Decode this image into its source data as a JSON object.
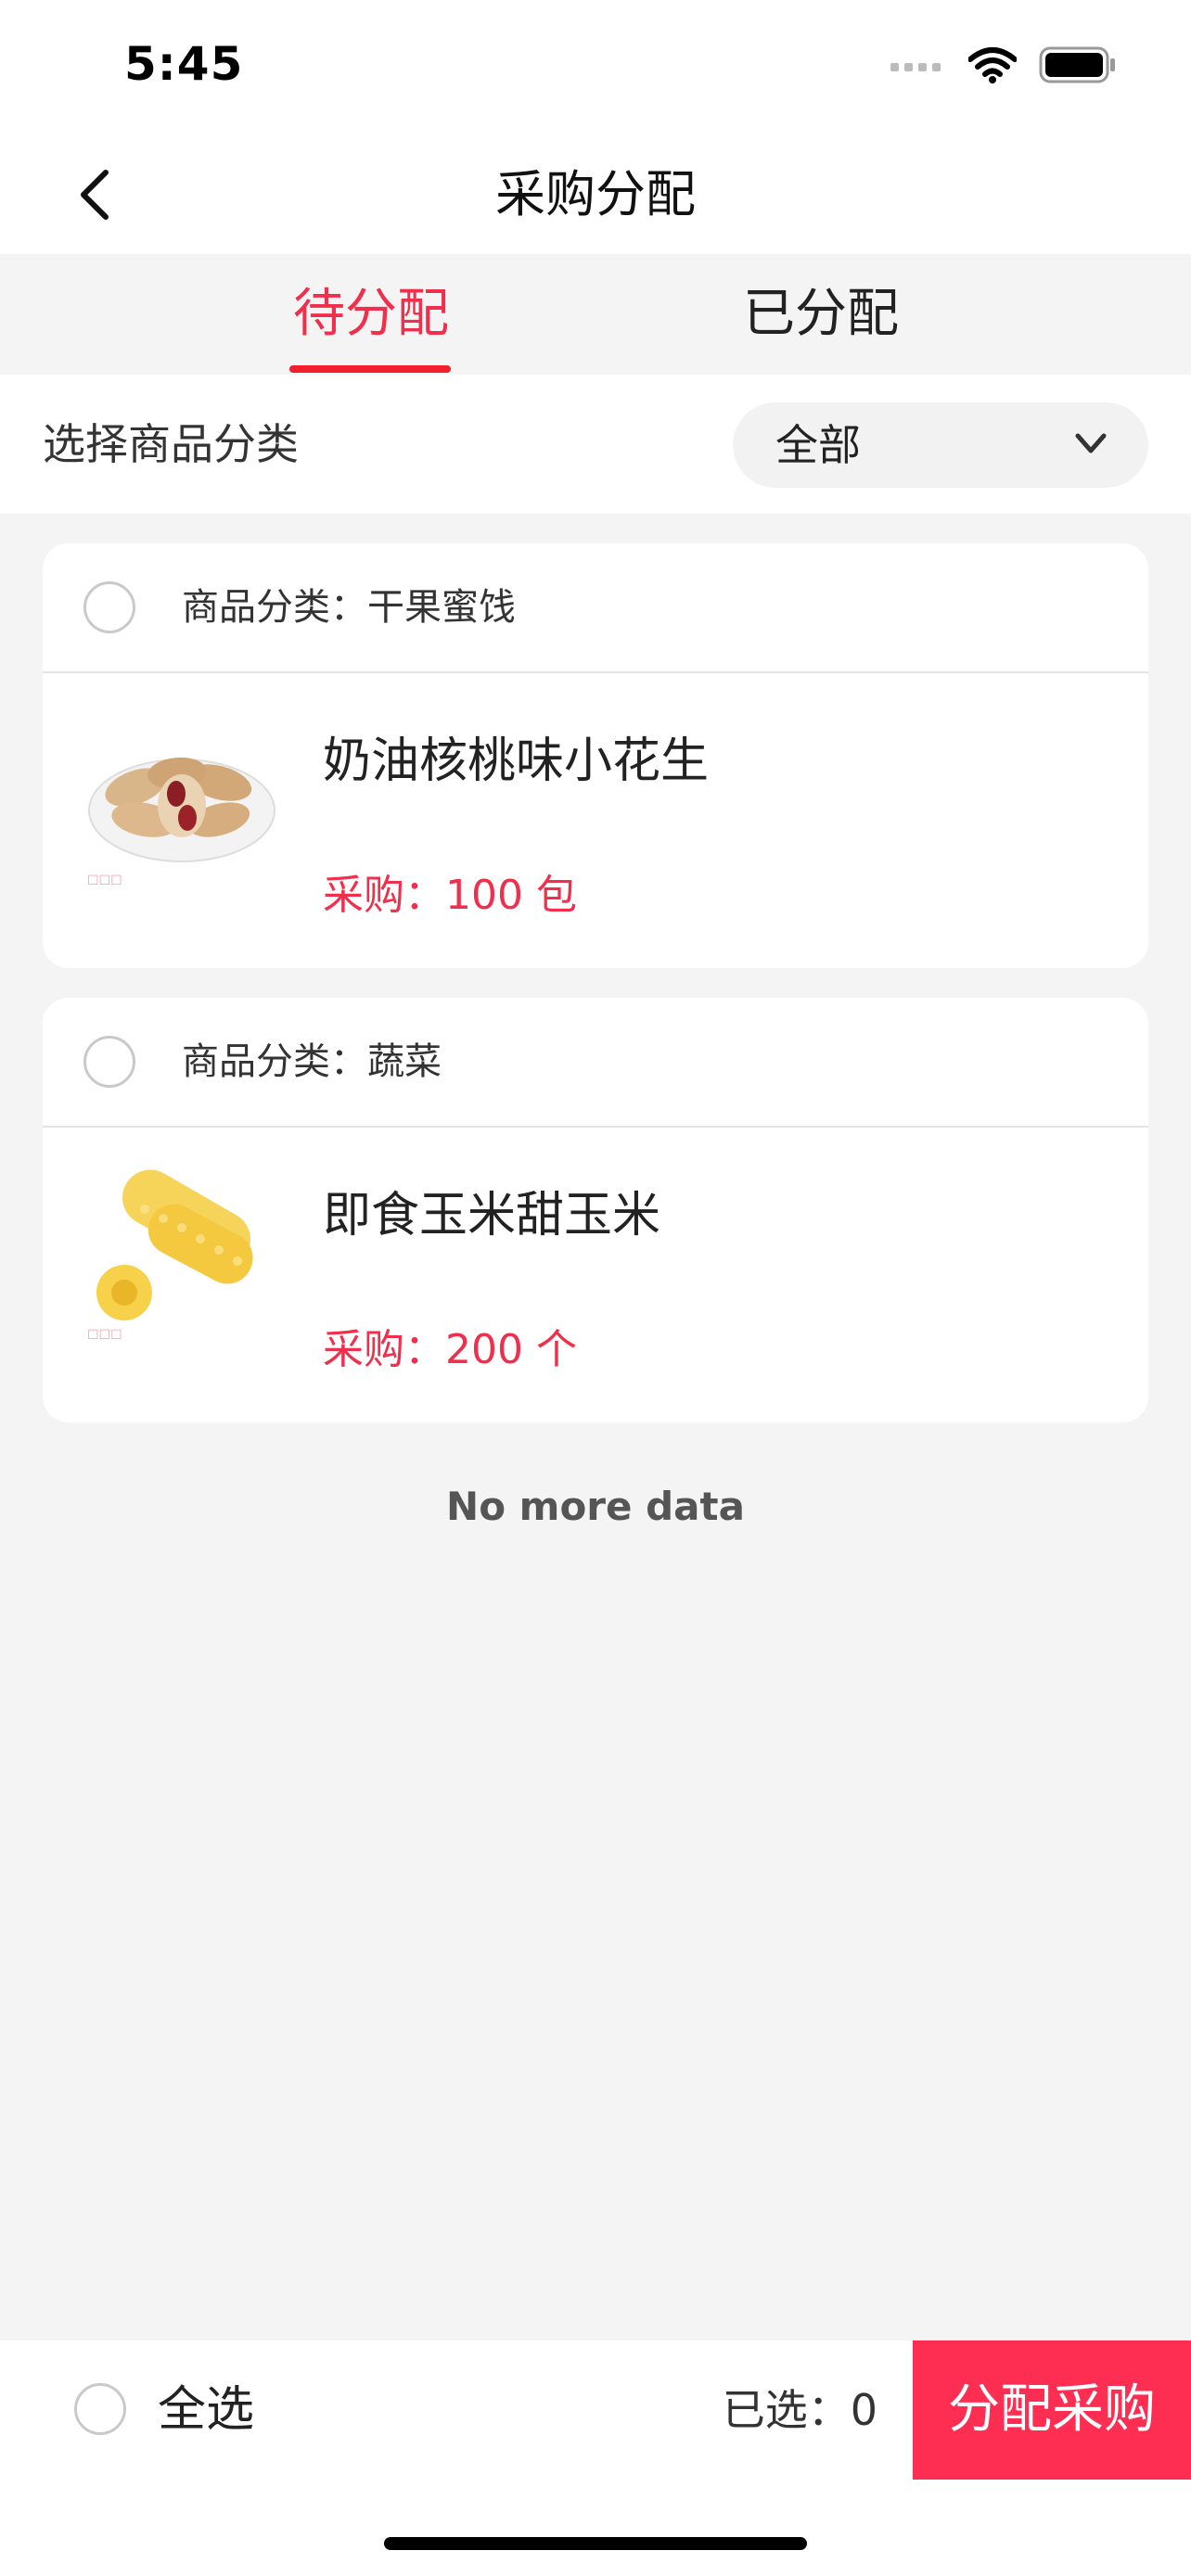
{
  "status_bar": {
    "time": "5:45"
  },
  "header": {
    "title": "采购分配"
  },
  "tabs": [
    {
      "label": "待分配",
      "active": true
    },
    {
      "label": "已分配",
      "active": false
    }
  ],
  "filter": {
    "label": "选择商品分类",
    "value": "全部"
  },
  "cards": [
    {
      "category": "商品分类：干果蜜饯",
      "product_name": "奶油核桃味小花生",
      "quantity": "采购：100 包",
      "image": "peanuts"
    },
    {
      "category": "商品分类：蔬菜",
      "product_name": "即食玉米甜玉米",
      "quantity": "采购：200 个",
      "image": "corn"
    }
  ],
  "footer_text": "No more data",
  "bottom_bar": {
    "select_all": "全选",
    "selected": "已选：0",
    "assign": "分配采购"
  },
  "colors": {
    "accent": "#ef2f4c",
    "button": "#fe2e53",
    "background": "#f4f4f4"
  }
}
